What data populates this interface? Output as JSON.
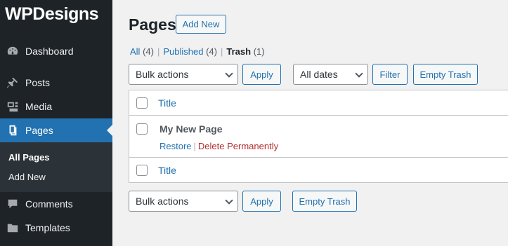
{
  "sidebar": {
    "logo": "WPDesigns",
    "items": [
      {
        "label": "Dashboard",
        "icon": "dashboard-icon"
      },
      {
        "label": "Posts",
        "icon": "pin-icon"
      },
      {
        "label": "Media",
        "icon": "media-icon"
      },
      {
        "label": "Pages",
        "icon": "pages-icon",
        "active": true
      },
      {
        "label": "Comments",
        "icon": "comment-icon"
      },
      {
        "label": "Templates",
        "icon": "folder-icon"
      }
    ],
    "submenu": [
      {
        "label": "All Pages",
        "current": true
      },
      {
        "label": "Add New"
      }
    ]
  },
  "header": {
    "title": "Pages",
    "add_new": "Add New"
  },
  "filters": {
    "all_label": "All",
    "all_count": "(4)",
    "published_label": "Published",
    "published_count": "(4)",
    "trash_label": "Trash",
    "trash_count": "(1)",
    "sep": "|"
  },
  "toolbar_top": {
    "bulk_actions": "Bulk actions",
    "apply": "Apply",
    "dates": "All dates",
    "filter": "Filter",
    "empty_trash": "Empty Trash"
  },
  "table": {
    "header_title": "Title",
    "footer_title": "Title",
    "rows": [
      {
        "title": "My New Page",
        "restore": "Restore",
        "delete": "Delete Permanently"
      }
    ]
  },
  "toolbar_bottom": {
    "bulk_actions": "Bulk actions",
    "apply": "Apply",
    "empty_trash": "Empty Trash"
  },
  "colors": {
    "sidebar_bg": "#1d2327",
    "accent": "#2271b1",
    "delete": "#b32d2e"
  }
}
